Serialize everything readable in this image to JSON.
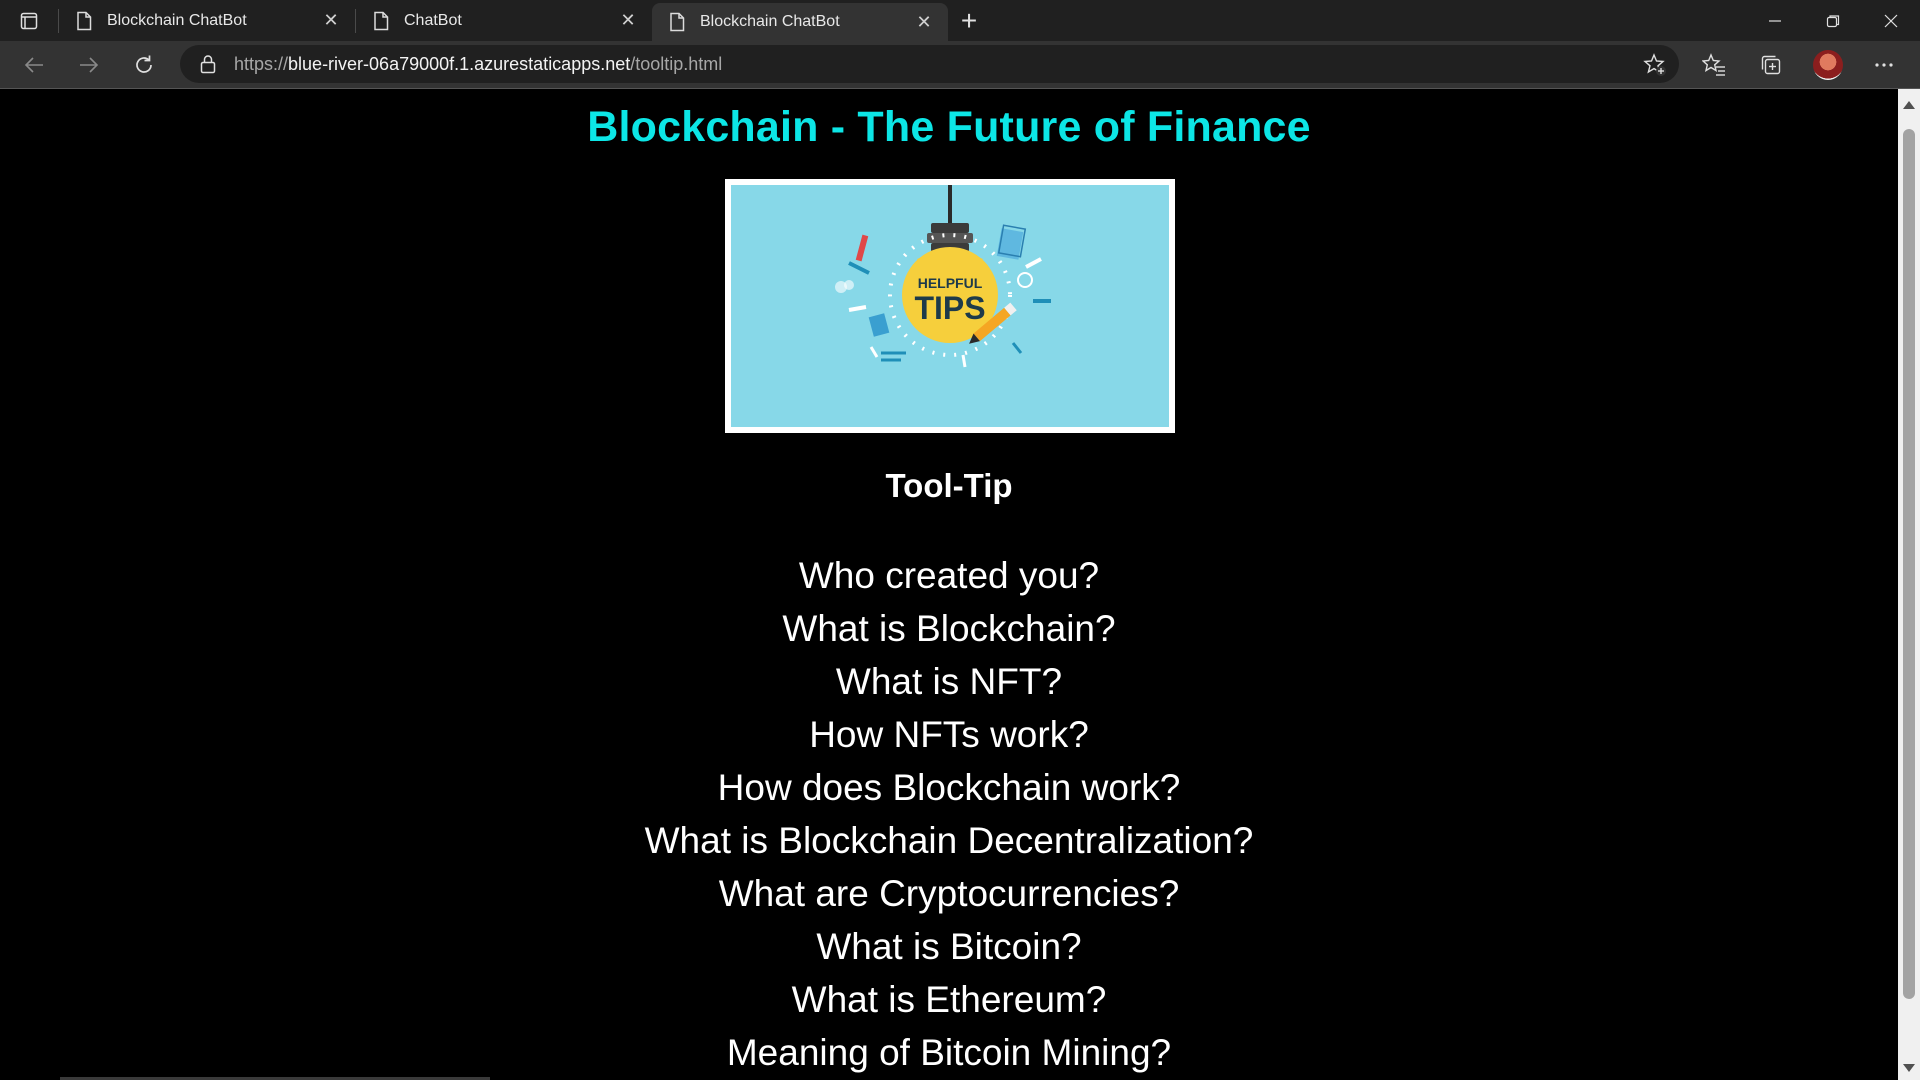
{
  "browser": {
    "tabs": [
      {
        "title": "Blockchain ChatBot",
        "active": false
      },
      {
        "title": "ChatBot",
        "active": false
      },
      {
        "title": "Blockchain ChatBot",
        "active": true
      }
    ],
    "url_prefix": "https://",
    "url_host": "blue-river-06a79000f.1.azurestaticapps.net",
    "url_path": "/tooltip.html",
    "icons": [
      "tab-actions-icon",
      "page-icon",
      "close-icon",
      "new-tab-icon",
      "minimize-icon",
      "restore-icon",
      "window-close-icon",
      "back-icon",
      "forward-icon",
      "refresh-icon",
      "lock-icon",
      "add-favorite-icon",
      "favorites-icon",
      "collections-icon",
      "profile-avatar",
      "more-icon"
    ]
  },
  "page": {
    "title": "Blockchain - The Future of Finance",
    "image": {
      "label_top": "HELPFUL",
      "label_bottom": "TIPS",
      "bg_color": "#87d8e8"
    },
    "section_heading": "Tool-Tip",
    "questions": [
      "Who created you?",
      "What is Blockchain?",
      "What is NFT?",
      "How NFTs work?",
      "How does Blockchain work?",
      "What is Blockchain Decentralization?",
      "What are Cryptocurrencies?",
      "What is Bitcoin?",
      "What is Ethereum?",
      "Meaning of Bitcoin Mining?"
    ]
  },
  "colors": {
    "title": "#0ce6e6",
    "page_bg": "#000000",
    "text": "#ffffff"
  }
}
